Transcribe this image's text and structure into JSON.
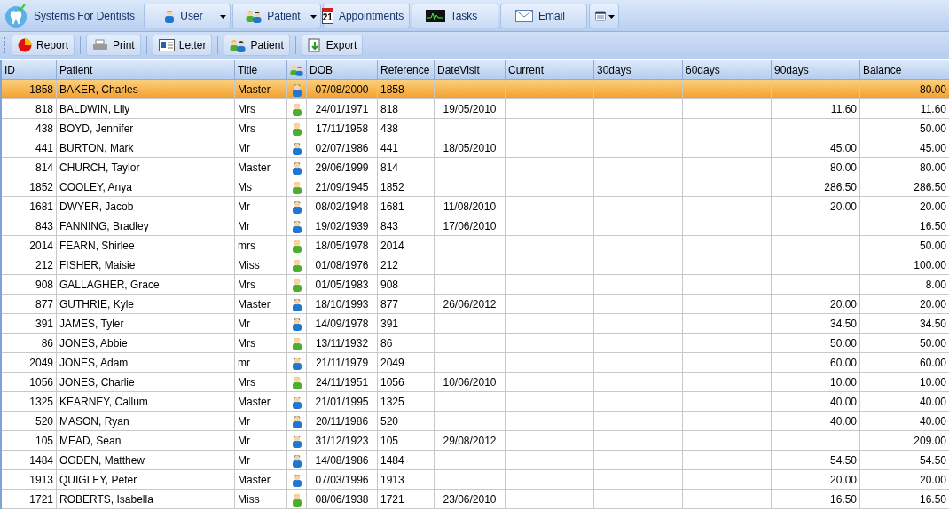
{
  "app": {
    "title": "Systems For Dentists"
  },
  "nav": [
    {
      "label": "User",
      "dropdown": true
    },
    {
      "label": "Patient",
      "dropdown": true
    },
    {
      "label": "Appointments",
      "badge": "21",
      "dropdown": false
    },
    {
      "label": "Tasks",
      "dropdown": false
    },
    {
      "label": "Email",
      "dropdown": false
    },
    {
      "dropdown": true
    }
  ],
  "toolbar": [
    {
      "label": "Report"
    },
    {
      "label": "Print"
    },
    {
      "label": "Letter"
    },
    {
      "label": "Patient"
    },
    {
      "label": "Export"
    }
  ],
  "columns": [
    {
      "label": "ID"
    },
    {
      "label": "Patient"
    },
    {
      "label": "Title"
    },
    {
      "kind": "icon"
    },
    {
      "label": "DOB"
    },
    {
      "label": "Reference"
    },
    {
      "label": "DateVisit"
    },
    {
      "label": "Current"
    },
    {
      "label": "30days"
    },
    {
      "label": "60days"
    },
    {
      "label": "90days"
    },
    {
      "label": "Balance"
    }
  ],
  "rows": [
    {
      "id": "1858",
      "patient": "BAKER, Charles",
      "title": "Master",
      "kind": "male",
      "dob": "07/08/2000",
      "reference": "1858",
      "balance": "80.00",
      "selected": true
    },
    {
      "id": "818",
      "patient": "BALDWIN, Lily",
      "title": "Mrs",
      "kind": "female",
      "dob": "24/01/1971",
      "reference": "818",
      "date_visit": "19/05/2010",
      "days_90": "11.60",
      "balance": "11.60",
      "selected": false
    },
    {
      "id": "438",
      "patient": "BOYD, Jennifer",
      "title": "Mrs",
      "kind": "female",
      "dob": "17/11/1958",
      "reference": "438",
      "balance": "50.00",
      "selected": false
    },
    {
      "id": "441",
      "patient": "BURTON, Mark",
      "title": "Mr",
      "kind": "male",
      "dob": "02/07/1986",
      "reference": "441",
      "date_visit": "18/05/2010",
      "days_90": "45.00",
      "balance": "45.00",
      "selected": false
    },
    {
      "id": "814",
      "patient": "CHURCH, Taylor",
      "title": "Master",
      "kind": "male",
      "dob": "29/06/1999",
      "reference": "814",
      "days_90": "80.00",
      "balance": "80.00",
      "selected": false
    },
    {
      "id": "1852",
      "patient": "COOLEY, Anya",
      "title": "Ms",
      "kind": "female",
      "dob": "21/09/1945",
      "reference": "1852",
      "days_90": "286.50",
      "balance": "286.50",
      "selected": false
    },
    {
      "id": "1681",
      "patient": "DWYER, Jacob",
      "title": "Mr",
      "kind": "male",
      "dob": "08/02/1948",
      "reference": "1681",
      "date_visit": "11/08/2010",
      "days_90": "20.00",
      "balance": "20.00",
      "selected": false
    },
    {
      "id": "843",
      "patient": "FANNING, Bradley",
      "title": "Mr",
      "kind": "male",
      "dob": "19/02/1939",
      "reference": "843",
      "date_visit": "17/06/2010",
      "balance": "16.50",
      "selected": false
    },
    {
      "id": "2014",
      "patient": "FEARN, Shirlee",
      "title": "mrs",
      "kind": "female",
      "dob": "18/05/1978",
      "reference": "2014",
      "balance": "50.00",
      "selected": false
    },
    {
      "id": "212",
      "patient": "FISHER, Maisie",
      "title": "Miss",
      "kind": "female",
      "dob": "01/08/1976",
      "reference": "212",
      "balance": "100.00",
      "selected": false
    },
    {
      "id": "908",
      "patient": "GALLAGHER, Grace",
      "title": "Mrs",
      "kind": "female",
      "dob": "01/05/1983",
      "reference": "908",
      "balance": "8.00",
      "selected": false
    },
    {
      "id": "877",
      "patient": "GUTHRIE, Kyle",
      "title": "Master",
      "kind": "male",
      "dob": "18/10/1993",
      "reference": "877",
      "date_visit": "26/06/2012",
      "days_90": "20.00",
      "balance": "20.00",
      "selected": false
    },
    {
      "id": "391",
      "patient": "JAMES, Tyler",
      "title": "Mr",
      "kind": "male",
      "dob": "14/09/1978",
      "reference": "391",
      "days_90": "34.50",
      "balance": "34.50",
      "selected": false
    },
    {
      "id": "86",
      "patient": "JONES, Abbie",
      "title": "Mrs",
      "kind": "female",
      "dob": "13/11/1932",
      "reference": "86",
      "days_90": "50.00",
      "balance": "50.00",
      "selected": false
    },
    {
      "id": "2049",
      "patient": "JONES, Adam",
      "title": "mr",
      "kind": "male",
      "dob": "21/11/1979",
      "reference": "2049",
      "days_90": "60.00",
      "balance": "60.00",
      "selected": false
    },
    {
      "id": "1056",
      "patient": "JONES, Charlie",
      "title": "Mrs",
      "kind": "female",
      "dob": "24/11/1951",
      "reference": "1056",
      "date_visit": "10/06/2010",
      "days_90": "10.00",
      "balance": "10.00",
      "selected": false
    },
    {
      "id": "1325",
      "patient": "KEARNEY, Callum",
      "title": "Master",
      "kind": "male",
      "dob": "21/01/1995",
      "reference": "1325",
      "days_90": "40.00",
      "balance": "40.00",
      "selected": false
    },
    {
      "id": "520",
      "patient": "MASON, Ryan",
      "title": "Mr",
      "kind": "male",
      "dob": "20/11/1986",
      "reference": "520",
      "days_90": "40.00",
      "balance": "40.00",
      "selected": false
    },
    {
      "id": "105",
      "patient": "MEAD, Sean",
      "title": "Mr",
      "kind": "male",
      "dob": "31/12/1923",
      "reference": "105",
      "date_visit": "29/08/2012",
      "balance": "209.00",
      "selected": false
    },
    {
      "id": "1484",
      "patient": "OGDEN, Matthew",
      "title": "Mr",
      "kind": "male",
      "dob": "14/08/1986",
      "reference": "1484",
      "days_90": "54.50",
      "balance": "54.50",
      "selected": false
    },
    {
      "id": "1913",
      "patient": "QUIGLEY, Peter",
      "title": "Master",
      "kind": "male",
      "dob": "07/03/1996",
      "reference": "1913",
      "days_90": "20.00",
      "balance": "20.00",
      "selected": false
    },
    {
      "id": "1721",
      "patient": "ROBERTS, Isabella",
      "title": "Miss",
      "kind": "female",
      "dob": "08/06/1938",
      "reference": "1721",
      "date_visit": "23/06/2010",
      "days_90": "16.50",
      "balance": "16.50",
      "selected": false
    }
  ]
}
